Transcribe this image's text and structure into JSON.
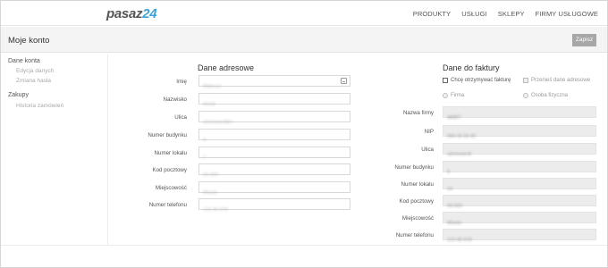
{
  "brand": {
    "logo_main": "pasaz",
    "logo_accent": "24"
  },
  "nav": [
    "PRODUKTY",
    "USŁUGI",
    "SKLEPY",
    "FIRMY USŁUGOWE"
  ],
  "header": {
    "title": "Moje konto",
    "save_label": "Zapisz"
  },
  "sidebar": {
    "sections": [
      {
        "label": "Dane konta",
        "items": [
          "Edycja danych",
          "Zmiana hasła"
        ]
      },
      {
        "label": "Zakupy",
        "items": [
          "Historia zamówień"
        ]
      }
    ]
  },
  "address": {
    "title": "Dane adresowe",
    "fields": [
      {
        "label": "Imię",
        "value": "Mateusz"
      },
      {
        "label": "Nazwisko",
        "value": "Wodž"
      },
      {
        "label": "Ulica",
        "value": "ulomrwerdt(cl"
      },
      {
        "label": "Numer budynku",
        "value": "9"
      },
      {
        "label": "Numer lokalu",
        "value": "7"
      },
      {
        "label": "Kod pocztowy",
        "value": "00-000"
      },
      {
        "label": "Miejscowość",
        "value": "Miasto"
      },
      {
        "label": "Numer telefonu",
        "value": "123 45 678"
      }
    ]
  },
  "invoice": {
    "title": "Dane do faktury",
    "want_invoice": "Chcę otrzymywać fakturę",
    "copy_address": "Przenieś dane adresowe",
    "type_company": "Firma",
    "type_person": "Osoba fizyczna",
    "fields": [
      {
        "label": "Nazwa firmy",
        "value": "ABBIT"
      },
      {
        "label": "NIP",
        "value": "999 00 00 00"
      },
      {
        "label": "Ulica",
        "value": "ulomrwerdt"
      },
      {
        "label": "Numer budynku",
        "value": "9"
      },
      {
        "label": "Numer lokalu",
        "value": "14"
      },
      {
        "label": "Kod pocztowy",
        "value": "00-000"
      },
      {
        "label": "Miejscowość",
        "value": "Miasto"
      },
      {
        "label": "Numer telefonu",
        "value": "123 45 678"
      }
    ]
  }
}
